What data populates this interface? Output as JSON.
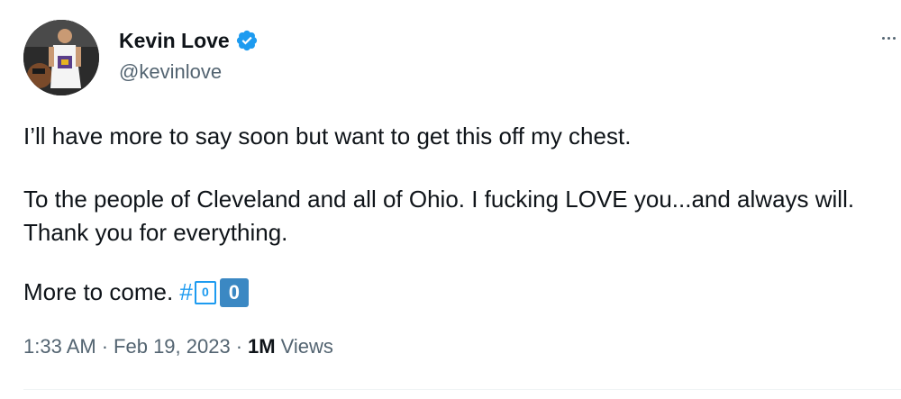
{
  "author": {
    "name": "Kevin Love",
    "handle": "@kevinlove",
    "verified": true,
    "avatar_icon": "profile-photo"
  },
  "menu_icon": "more-horizontal-icon",
  "tweet": {
    "line1": "I’ll have more to say soon but want to get this off my chest.",
    "line2": "To the people of Cleveland and all of Ohio. I fucking LOVE you...and always will. Thank you for everything.",
    "line3_text": "More to come.",
    "hashtag": {
      "symbol": "#",
      "key_outline": "0",
      "key_solid": "0"
    }
  },
  "meta": {
    "time": "1:33 AM",
    "separator": "·",
    "date": "Feb 19, 2023",
    "views_count": "1M",
    "views_label": "Views"
  },
  "colors": {
    "text": "#0f1419",
    "secondary": "#536471",
    "link": "#1d9bf0",
    "verified": "#1d9bf0",
    "keycap": "#3b88c3"
  }
}
